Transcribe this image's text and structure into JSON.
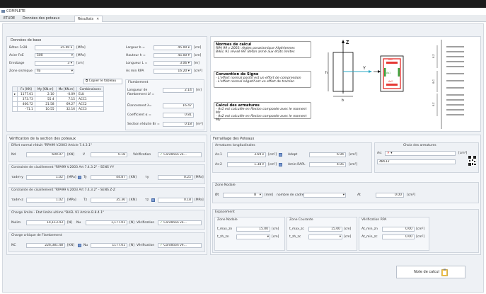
{
  "app": {
    "title": "COMPLETE"
  },
  "tabs": [
    {
      "label": "ETUDE"
    },
    {
      "label": "Données des poteaux"
    },
    {
      "label": "Résultats",
      "close": "✕"
    }
  ],
  "base": {
    "title": "Données de base",
    "beton_label": "Béton Fc28",
    "beton_value": "25.00",
    "beton_unit": "[MPa]",
    "acier_label": "Acier FeE",
    "acier_value": "500",
    "acier_unit": "[MPa]",
    "enrobage_label": "Enrobage",
    "enrobage_value": "3",
    "enrobage_unit": "[cm]",
    "zone_label": "Zone sismique",
    "zone_value": "IIa",
    "largeur_label": "Largeur b =",
    "largeur_value": "45.00",
    "largeur_unit": "[cm]",
    "hauteur_label": "Hauteur h =",
    "hauteur_value": "45.00",
    "hauteur_unit": "[cm]",
    "longueur_label": "Longueur L =",
    "longueur_value": "3.06",
    "longueur_unit": "[m]",
    "asmin_label": "As min RPA",
    "asmin_value": "16.20",
    "asmin_unit": "[cm²]"
  },
  "table": {
    "copy_label": "Copier le tableau",
    "headers": [
      "Fx [KN]",
      "My [KN.m]",
      "Mz [KN.m]",
      "Combinaisons"
    ],
    "rows": [
      [
        "1177.01",
        "2.10",
        "-0.09",
        "ELU"
      ],
      [
        "373.73",
        "55.4",
        "7.15",
        "ACC1"
      ],
      [
        "406.72",
        "21.58",
        "69.27",
        "ACC2"
      ],
      [
        "-71.1",
        "10.55",
        "32.16",
        "ACC3"
      ]
    ]
  },
  "flambement": {
    "title": "Flambement",
    "longueur_label": "Longueur de flambement Lf =",
    "longueur_value": "2.14",
    "longueur_unit": "[m]",
    "elancement_label": "Élancement λ=",
    "elancement_value": "16.47",
    "coef_label": "Coefficient α =",
    "coef_value": "0.81",
    "section_label": "Section réduite Br =",
    "section_value": "0.18",
    "section_unit": "[m²]"
  },
  "notes": {
    "n1_title": "Normes de calcul",
    "n1_l1": "RPA 99 v 2003: règles parasismique Algériennes",
    "n1_l2": "BAEL 91 révisé 99: Béton armé aux états limites",
    "n2_title": "Convention de Signe",
    "n2_l1": "- L'effort normal positif est un effort de compression",
    "n2_l2": "- L'effort normal négatif est un effort de traction",
    "n3_title": "Calcul des armatures",
    "n3_l1": "- As1 est calculée en flexion composée avec le moment Mz",
    "n3_l2": "- As2 est calculée en flexion composée avec le moment My",
    "axis_z": "Z",
    "axis_y": "Y",
    "dim_b": "b",
    "dim_h": "h",
    "as1": "As1",
    "as2": "As2",
    "dim_e": "e",
    "dim_sc": "S.C",
    "dim_sz": "S.Z"
  },
  "verif": {
    "title": "Vérification de la section des poteaux",
    "g1_title": "Effort normal réduit \"RPA99 V.2003 Article 7.4.3.1\"",
    "g1_nd_label": "Nd",
    "g1_nd_value": "600.07",
    "g1_nd_unit": "[KN]",
    "g1_v_label": "V",
    "g1_v_value": "0.18",
    "g1_verif_label": "Vérification",
    "g1_status": "Condition vé...",
    "g2_title": "Contrainte de cisaillement \"RPA99 V.2003 Art 7.4.3.2\" - SENS Y-Y",
    "g2_label": "τadm-y",
    "g2_value": "1.02",
    "g2_unit": "[MPa]",
    "g2_t_label": "Ty",
    "g2_t_value": "44.87",
    "g2_t_unit": "[KN]",
    "g2_tau_label": "τy",
    "g2_tau_value": "0.25",
    "g2_tau_unit": "[MPa]",
    "g3_title": "Contrainte de cisaillement \"RPA99 V.2003 Art 7.4.3.2\" - SENS Z-Z",
    "g3_label": "τadm-z",
    "g3_value": "1.02",
    "g3_unit": "[MPa]",
    "g3_t_label": "Tz",
    "g3_t_value": "35.36",
    "g3_t_unit": "[KN]",
    "g3_tau_label": "τz",
    "g3_tau_value": "0.18",
    "g3_tau_unit": "[MPa]",
    "g4_title": "Charge limite - Etat limite ultime \"BAEL 91 Article B.8.4.1\"",
    "g4_label": "Nulim",
    "g4_value": "14,113.43",
    "g4_unit": "[N]",
    "g4_nu_label": "Nu",
    "g4_nu_value": "1,177.01",
    "g4_nu_unit": "[N]",
    "g4_verif_label": "Vérification",
    "g4_status": "Condition vé...",
    "g5_title": "Charge critique de Flambement",
    "g5_label": "NC",
    "g5_value": "226,381.48",
    "g5_unit": "[KN]",
    "g5_nu_label": "Nu",
    "g5_nu_value": "1177.01",
    "g5_nu_unit": "[N]",
    "g5_verif_label": "Vérification",
    "g5_status": "Condition vé..."
  },
  "ferraillage": {
    "title": "Ferraillage des Poteaux",
    "long_title": "Armatures longitudinales",
    "as1_label": "As-1",
    "as1_value": "3.69",
    "as1_unit": "[cm²]",
    "adopt_label": "Adopt",
    "adopt_value": "6.94",
    "adopt_unit": "[cm²]",
    "as2_label": "As-2",
    "as2_value": "1.38",
    "as2_unit": "[cm²]",
    "amin_label": "Amin-RAPL",
    "amin_value": "4.05",
    "amin_unit": "[cm²]",
    "choix_title": "Choix des armatures",
    "choix_as_label": "As:",
    "choix_unit": "[cm²]",
    "choix_value": "4ØL12",
    "zone_nodale_title": "Zone Nodale",
    "phi_label": "Øt",
    "phi_value": "8",
    "phi_unit": "[mm]",
    "cadre_label": "nombre de cadre",
    "at_label": "At",
    "at_value": "0.00",
    "at_unit": "[cm²]",
    "esp_title": "Espacement",
    "zn_title": "Zone Nodale",
    "zn_l1": "t_max_zn",
    "zn_v1": "15.00",
    "zn_u1": "[cm]",
    "zn_l2": "t_zh_zn",
    "zn_u2": "[cm]",
    "zc_title": "Zone Courante",
    "zc_l1": "t_max_zc",
    "zc_v1": "15.00",
    "zc_u1": "[cm]",
    "zc_l2": "t_zh_zc",
    "zc_u2": "[cm]",
    "vr_title": "Vérification RPA",
    "vr_l1": "At_min_zn",
    "vr_v1": "0.00",
    "vr_u1": "[cm²]",
    "vr_l2": "At_min_zc",
    "vr_v2": "0.00",
    "vr_u2": "[cm²]"
  },
  "note_button": "Note de calcul",
  "colors": {
    "accent": "#7d9bd1",
    "red": "#e53935",
    "green": "#3da13d"
  }
}
